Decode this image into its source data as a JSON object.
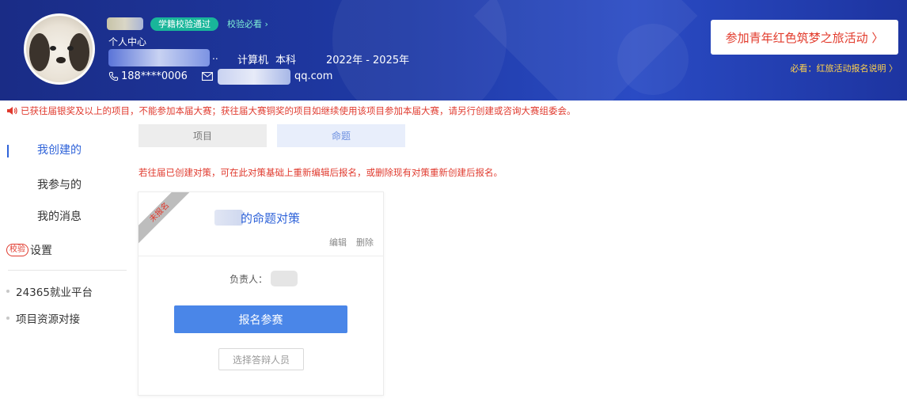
{
  "header": {
    "badge_verified": "学籍校验通过",
    "link_must_read": "校验必看 ›",
    "section_label": "个人中心",
    "dots": "..",
    "major": "计算机",
    "degree": "本科",
    "years": "2022年 - 2025年",
    "phone": "188****0006",
    "email_domain": "qq.com",
    "join_button": "参加青年红色筑梦之旅活动 〉",
    "rule_link": "必看：红旅活动报名说明 〉"
  },
  "notice": {
    "text": "已获往届银奖及以上的项目，不能参加本届大赛；获往届大赛铜奖的项目如继续使用该项目参加本届大赛，请另行创建或咨询大赛组委会。"
  },
  "sidebar": {
    "items": [
      {
        "label": "我创建的"
      },
      {
        "label": "我参与的"
      },
      {
        "label": "我的消息"
      },
      {
        "label": "设置",
        "badge": "校验"
      }
    ],
    "links": [
      {
        "label": "24365就业平台"
      },
      {
        "label": "项目资源对接"
      }
    ]
  },
  "main": {
    "tabs": [
      {
        "label": "项目"
      },
      {
        "label": "命题"
      }
    ],
    "hint": "若往届已创建对策，可在此对策基础上重新编辑后报名，或删除现有对策重新创建后报名。",
    "card": {
      "ribbon": "未报名",
      "title": "的命题对策",
      "edit": "编辑",
      "delete": "删除",
      "owner_label": "负责人：",
      "register_button": "报名参赛",
      "select_button": "选择答辩人员"
    }
  },
  "colors": {
    "header_blue": "#1f3aa6",
    "accent_blue": "#2f63d9",
    "warning_red": "#e03a2e",
    "primary_button": "#4a86e8",
    "verified_green": "#19b69a",
    "rule_yellow": "#ffd24c"
  },
  "icons": {
    "notice": "speaker-icon",
    "phone": "phone-icon",
    "mail": "mail-icon"
  }
}
